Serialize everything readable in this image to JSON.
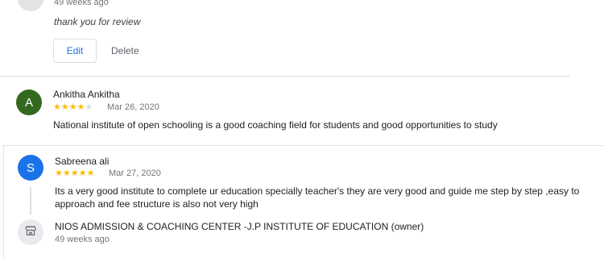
{
  "owner_reply_top": {
    "time": "49 weeks ago",
    "text": "thank you for review",
    "edit_label": "Edit",
    "delete_label": "Delete"
  },
  "reviews": [
    {
      "avatar_letter": "A",
      "avatar_color": "#33691e",
      "name": "Ankitha Ankitha",
      "rating": 4,
      "date": "Mar 26, 2020",
      "text": "National institute of open schooling is a good coaching field for students and good opportunities to study"
    },
    {
      "avatar_letter": "S",
      "avatar_color": "#1a73e8",
      "name": "Sabreena ali",
      "rating": 5,
      "date": "Mar 27, 2020",
      "text": "Its a very good institute to complete ur education specially teacher's they are very good and guide me step by step ,easy to approach and fee structure is also not very high",
      "owner_reply": {
        "icon": "store-icon",
        "name": "NIOS ADMISSION & COACHING CENTER -J.P INSTITUTE OF EDUCATION (owner)",
        "time": "49 weeks ago"
      }
    }
  ],
  "colors": {
    "star": "#fbbc04",
    "star_empty": "#dadce0",
    "link": "#1a73e8"
  }
}
